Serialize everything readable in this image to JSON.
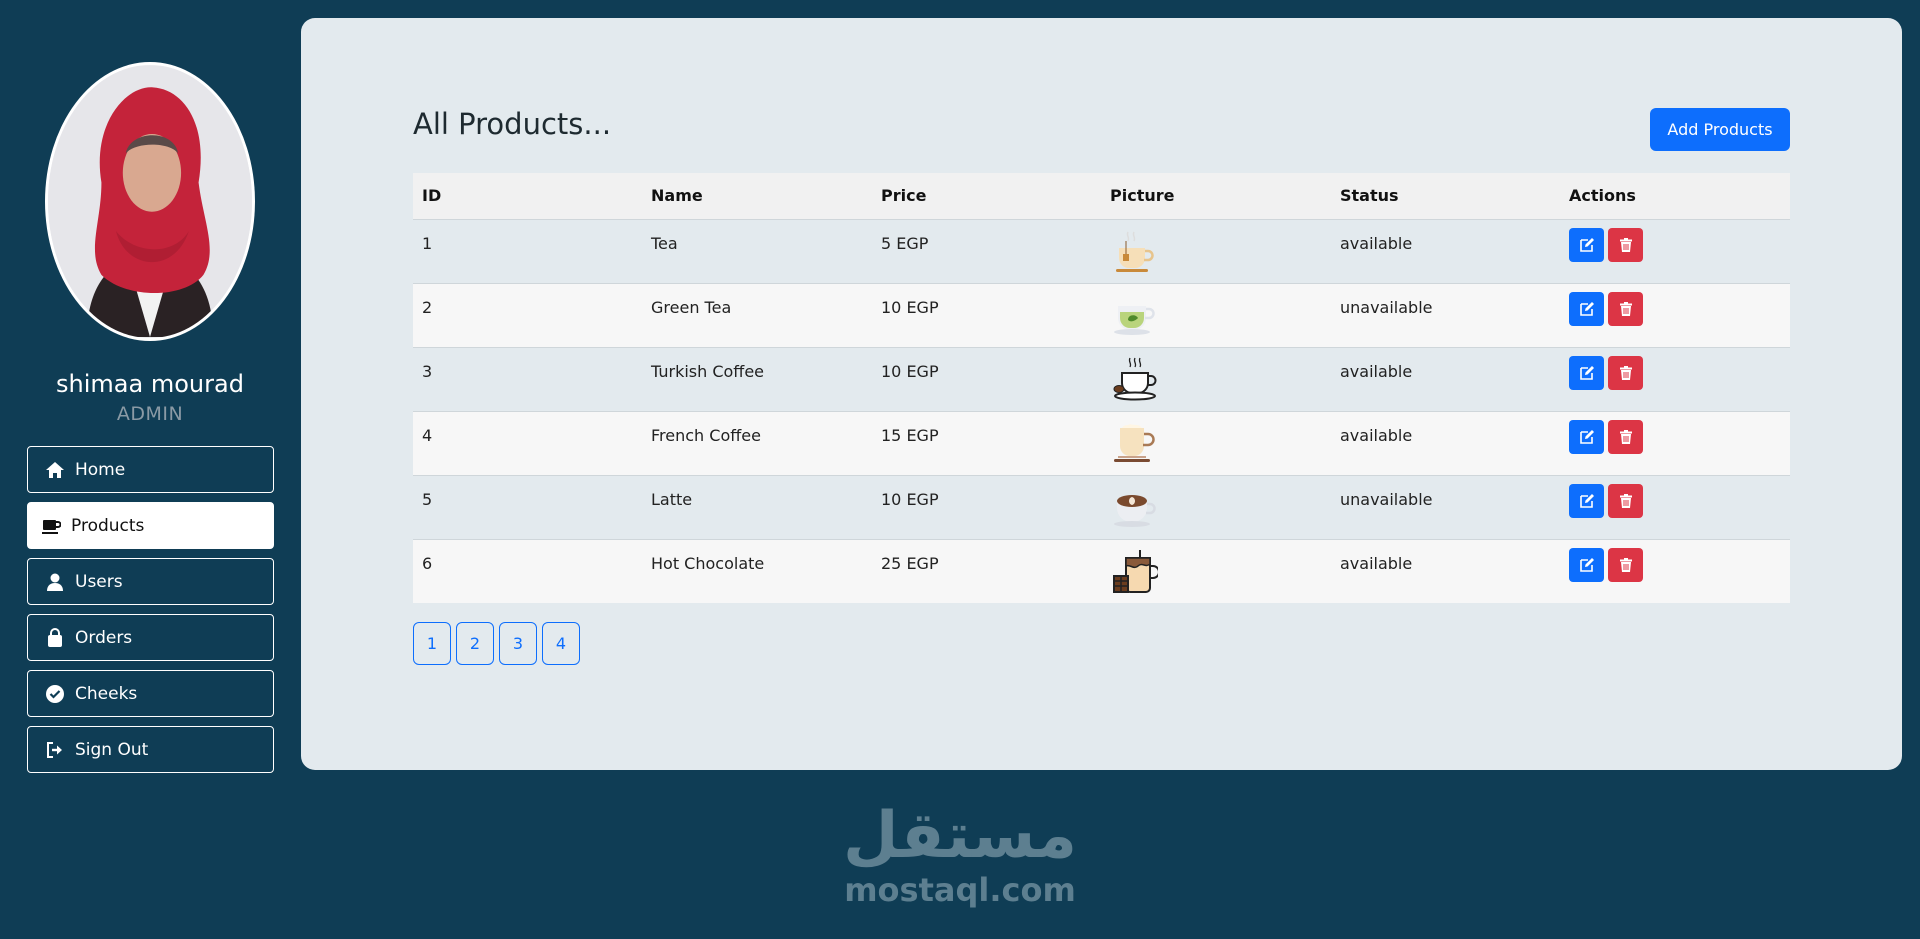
{
  "user": {
    "name": "shimaa mourad",
    "role": "ADMIN"
  },
  "nav": [
    {
      "label": "Home",
      "icon": "home-icon",
      "active": false
    },
    {
      "label": "Products",
      "icon": "coffee-mug-icon",
      "active": true
    },
    {
      "label": "Users",
      "icon": "user-icon",
      "active": false
    },
    {
      "label": "Orders",
      "icon": "shopping-bag-icon",
      "active": false
    },
    {
      "label": "Cheeks",
      "icon": "check-circle-icon",
      "active": false
    },
    {
      "label": "Sign Out",
      "icon": "sign-out-icon",
      "active": false
    }
  ],
  "main": {
    "title": "All Products...",
    "add_button": "Add Products",
    "columns": [
      "ID",
      "Name",
      "Price",
      "Picture",
      "Status",
      "Actions"
    ],
    "rows": [
      {
        "id": "1",
        "name": "Tea",
        "price": "5 EGP",
        "picture": "tea-cup-icon",
        "status": "available"
      },
      {
        "id": "2",
        "name": "Green Tea",
        "price": "10 EGP",
        "picture": "green-tea-icon",
        "status": "unavailable"
      },
      {
        "id": "3",
        "name": "Turkish Coffee",
        "price": "10 EGP",
        "picture": "turkish-coffee-icon",
        "status": "available"
      },
      {
        "id": "4",
        "name": "French Coffee",
        "price": "15 EGP",
        "picture": "french-coffee-icon",
        "status": "available"
      },
      {
        "id": "5",
        "name": "Latte",
        "price": "10 EGP",
        "picture": "latte-icon",
        "status": "unavailable"
      },
      {
        "id": "6",
        "name": "Hot Chocolate",
        "price": "25 EGP",
        "picture": "hot-chocolate-icon",
        "status": "available"
      }
    ],
    "pages": [
      "1",
      "2",
      "3",
      "4"
    ]
  },
  "watermark": {
    "arabic": "مستقل",
    "latin": "mostaql.com"
  },
  "colors": {
    "background": "#0f3d55",
    "card": "#e3eaee",
    "primary": "#0d6efd",
    "danger": "#dc3545"
  }
}
